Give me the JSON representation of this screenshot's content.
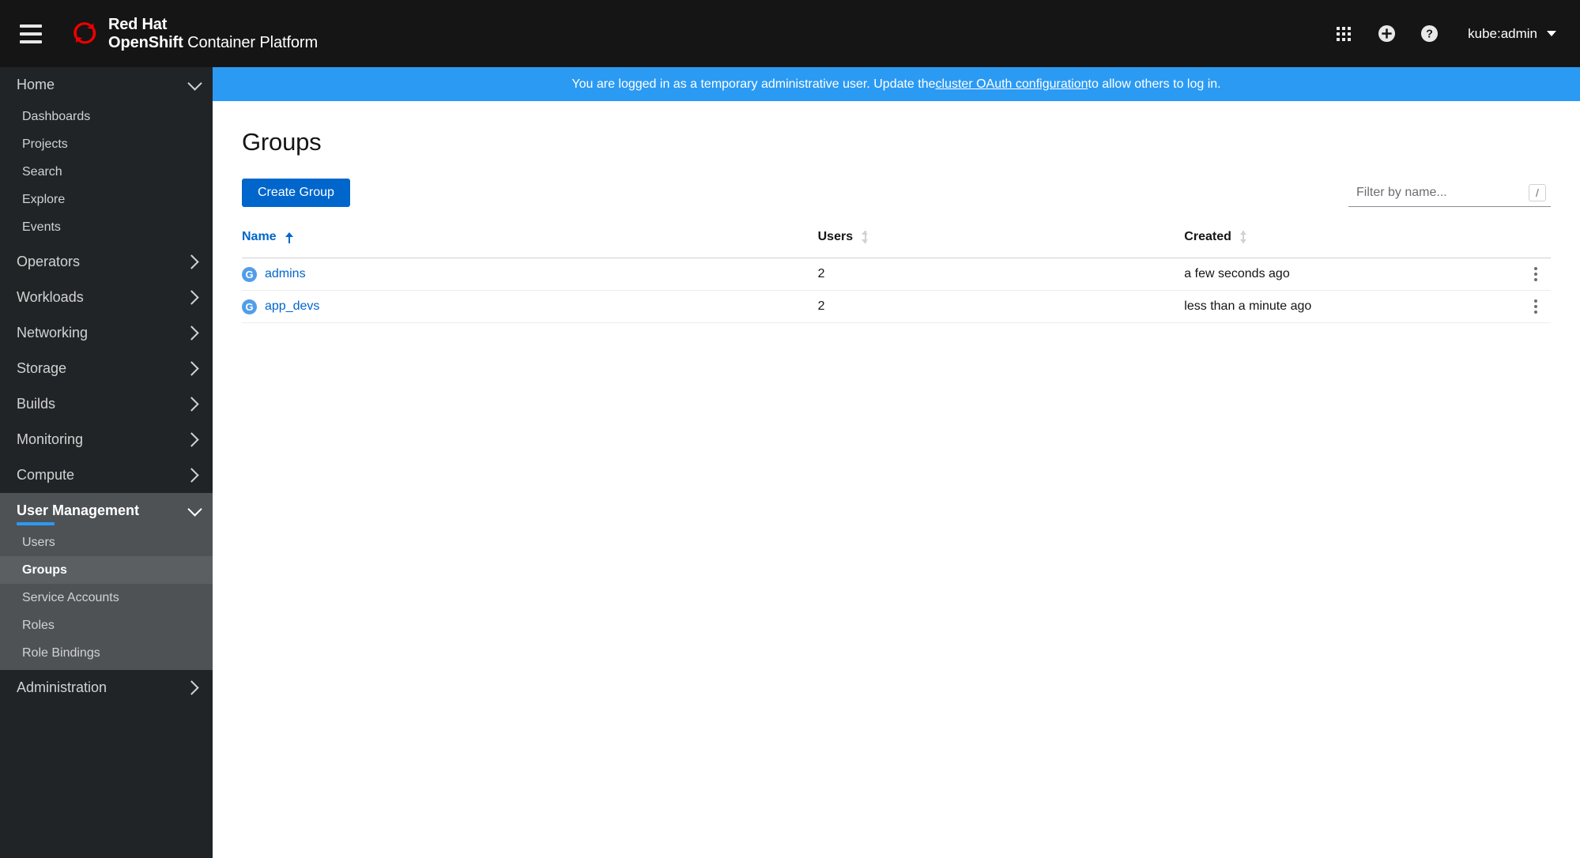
{
  "masthead": {
    "hamburger_icon": "hamburger-menu-icon",
    "brand_line1": "Red Hat",
    "brand_line2_bold": "OpenShift",
    "brand_line2_rest": " Container Platform",
    "logo_icon": "red-hat-logo-icon",
    "brand_accent": "#ee0000",
    "background": "#151515",
    "tools": [
      {
        "icon": "application-launcher-grid-icon",
        "label": "Application launcher"
      },
      {
        "icon": "plus-circle-icon",
        "label": "Quick create"
      },
      {
        "icon": "question-circle-help-icon",
        "label": "Help"
      }
    ],
    "user": {
      "name": "kube:admin",
      "caret_icon": "caret-down-icon"
    }
  },
  "notice": {
    "text_before": "You are logged in as a temporary administrative user. Update the ",
    "link_text": "cluster OAuth configuration",
    "text_after": " to allow others to log in.",
    "background": "#2b9af3"
  },
  "sidebar": {
    "background": "#212427",
    "active_section_background": "#4f5255",
    "selected_item_background": "#5b5f62",
    "accent": "#2b9af3",
    "groups": [
      {
        "label": "Home",
        "expanded": true,
        "chevron_icon": "chevron-down-icon",
        "items": [
          {
            "label": "Dashboards",
            "selected": false
          },
          {
            "label": "Projects",
            "selected": false
          },
          {
            "label": "Search",
            "selected": false
          },
          {
            "label": "Explore",
            "selected": false
          },
          {
            "label": "Events",
            "selected": false
          }
        ]
      },
      {
        "label": "Operators",
        "expanded": false,
        "chevron_icon": "chevron-right-icon",
        "items": []
      },
      {
        "label": "Workloads",
        "expanded": false,
        "chevron_icon": "chevron-right-icon",
        "items": []
      },
      {
        "label": "Networking",
        "expanded": false,
        "chevron_icon": "chevron-right-icon",
        "items": []
      },
      {
        "label": "Storage",
        "expanded": false,
        "chevron_icon": "chevron-right-icon",
        "items": []
      },
      {
        "label": "Builds",
        "expanded": false,
        "chevron_icon": "chevron-right-icon",
        "items": []
      },
      {
        "label": "Monitoring",
        "expanded": false,
        "chevron_icon": "chevron-right-icon",
        "items": []
      },
      {
        "label": "Compute",
        "expanded": false,
        "chevron_icon": "chevron-right-icon",
        "items": []
      },
      {
        "label": "User Management",
        "expanded": true,
        "active": true,
        "chevron_icon": "chevron-down-icon",
        "items": [
          {
            "label": "Users",
            "selected": false
          },
          {
            "label": "Groups",
            "selected": true
          },
          {
            "label": "Service Accounts",
            "selected": false
          },
          {
            "label": "Roles",
            "selected": false
          },
          {
            "label": "Role Bindings",
            "selected": false
          }
        ]
      },
      {
        "label": "Administration",
        "expanded": false,
        "chevron_icon": "chevron-right-icon",
        "items": []
      }
    ]
  },
  "page": {
    "title": "Groups",
    "create_button": "Create Group",
    "create_button_color": "#0066cc",
    "filter": {
      "placeholder": "Filter by name...",
      "value": "",
      "shortcut_badge": "/"
    }
  },
  "table": {
    "columns": [
      {
        "label": "Name",
        "sorted": true,
        "sort_direction": "asc",
        "sort_icon": "sort-arrow-up-icon"
      },
      {
        "label": "Users",
        "sorted": false,
        "sort_direction": "none",
        "sort_icon": "sort-both-icon"
      },
      {
        "label": "Created",
        "sorted": false,
        "sort_direction": "none",
        "sort_icon": "sort-both-icon"
      }
    ],
    "rows": [
      {
        "badge": "G",
        "name": "admins",
        "users": "2",
        "created": "a few seconds ago",
        "actions_icon": "kebab-menu-icon"
      },
      {
        "badge": "G",
        "name": "app_devs",
        "users": "2",
        "created": "less than a minute ago",
        "actions_icon": "kebab-menu-icon"
      }
    ]
  }
}
